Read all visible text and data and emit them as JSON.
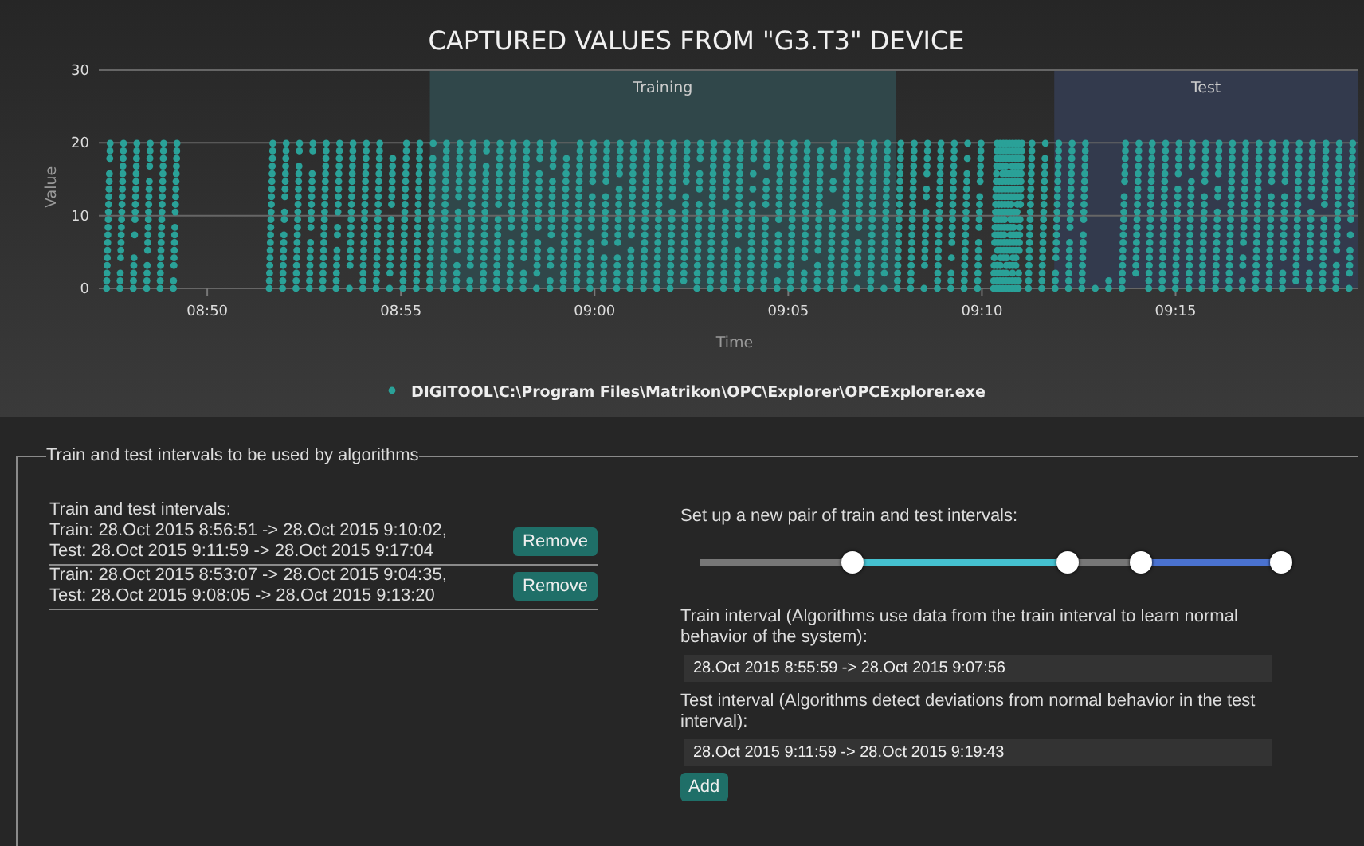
{
  "chart": {
    "title": "CAPTURED VALUES FROM \"G3.T3\" DEVICE",
    "xlabel": "Time",
    "ylabel": "Value",
    "yticks": [
      "30",
      "20",
      "10",
      "0"
    ],
    "xticks": [
      "08:50",
      "08:55",
      "09:00",
      "09:05",
      "09:10",
      "09:15"
    ],
    "bands": [
      {
        "label": "Training",
        "color": "#30474a"
      },
      {
        "label": "Test",
        "color": "#333a4d"
      }
    ],
    "legend": {
      "label": "DIGITOOL\\C:\\Program Files\\Matrikon\\OPC\\Explorer\\OPCExplorer.exe",
      "color": "#2aa198"
    }
  },
  "intervals": {
    "legend": "Train and test intervals to be used by algorithms",
    "heading": "Train and test intervals:",
    "rows": [
      {
        "train": "Train: 28.Oct 2015 8:56:51 -> 28.Oct 2015 9:10:02,",
        "test": "Test: 28.Oct 2015 9:11:59 -> 28.Oct 2015 9:17:04",
        "button": "Remove"
      },
      {
        "train": "Train: 28.Oct 2015 8:53:07 -> 28.Oct 2015 9:04:35,",
        "test": "Test: 28.Oct 2015 9:08:05 -> 28.Oct 2015 9:13:20",
        "button": "Remove"
      }
    ]
  },
  "new_pair": {
    "heading": "Set up a new pair of train and test intervals:",
    "slider": {
      "handles": [
        {
          "level": 0.263
        },
        {
          "level": 0.633
        },
        {
          "level": 0.759
        },
        {
          "level": 1.0
        }
      ]
    },
    "train_label": "Train interval (Algorithms use data from the train interval to learn normal behavior of the system):",
    "train_value": "28.Oct 2015 8:55:59 -> 28.Oct 2015 9:07:56",
    "test_label": "Test interval (Algorithms detect deviations from normal behavior in the test interval):",
    "test_value": "28.Oct 2015 9:11:59 -> 28.Oct 2015 9:19:43",
    "add_button": "Add"
  }
}
